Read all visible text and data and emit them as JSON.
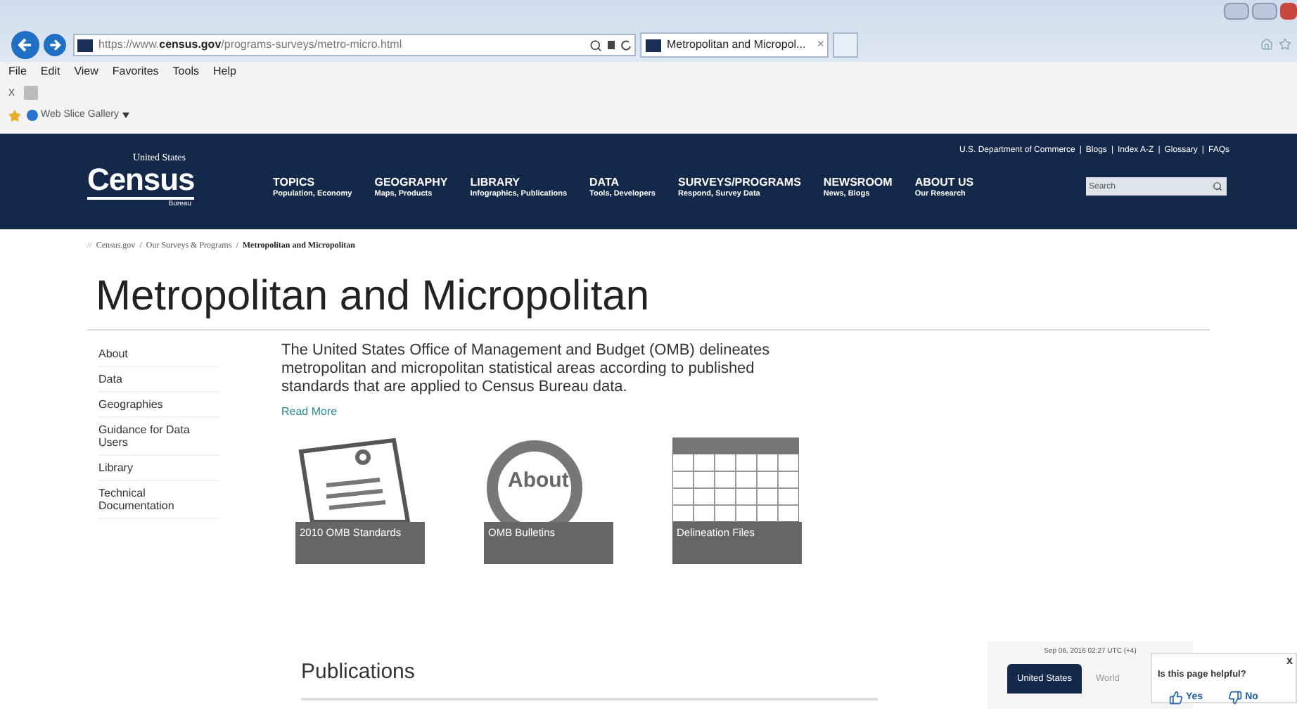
{
  "browser": {
    "url": "https://www.**census.gov**/programs-surveys/metro-micro.html",
    "tab_title": "Metropolitan and Micropol...",
    "tab_close": "×",
    "menu": [
      "File",
      "Edit",
      "View",
      "Favorites",
      "Tools",
      "Help"
    ],
    "command_close": "x",
    "favorites": [
      {
        "label": "Web Slice Gallery"
      }
    ]
  },
  "header": {
    "logo": {
      "top": "United States",
      "main": "Census",
      "bottom": "Bureau"
    },
    "top_links": [
      "U.S. Department of Commerce",
      "Blogs",
      "Index A-Z",
      "Glossary",
      "FAQs"
    ],
    "top_links_separator": "|",
    "nav": [
      {
        "title": "TOPICS",
        "subtitle": "Population, Economy"
      },
      {
        "title": "GEOGRAPHY",
        "subtitle": "Maps, Products"
      },
      {
        "title": "LIBRARY",
        "subtitle": "Infographics, Publications"
      },
      {
        "title": "DATA",
        "subtitle": "Tools, Developers"
      },
      {
        "title": "SURVEYS/PROGRAMS",
        "subtitle": "Respond, Survey Data"
      },
      {
        "title": "NEWSROOM",
        "subtitle": "News, Blogs"
      },
      {
        "title": "ABOUT US",
        "subtitle": "Our Research"
      }
    ],
    "search": {
      "placeholder": "Search"
    }
  },
  "breadcrumb": {
    "prefix": "//",
    "separator": "/",
    "items": [
      "Census.gov",
      "Our Surveys & Programs",
      "Metropolitan and Micropolitan"
    ]
  },
  "page_title": "Metropolitan and Micropolitan",
  "sidebar": {
    "items": [
      "About",
      "Data",
      "Geographies",
      "Guidance for Data Users",
      "Library",
      "Technical Documentation"
    ]
  },
  "intro": "The United States Office of Management and Budget (OMB) delineates metropolitan and micropolitan statistical areas according to published standards that are applied to Census Bureau data.",
  "read_more": "Read More",
  "tiles": [
    {
      "kind": "document",
      "caption": "2010 OMB Standards"
    },
    {
      "kind": "magnifier",
      "caption": "OMB Bulletins",
      "art_text": "About"
    },
    {
      "kind": "grid",
      "caption": "Delineation Files"
    }
  ],
  "publications": {
    "heading": "Publications"
  },
  "widget": {
    "timestamp": "Sep 06, 2016 02:27 UTC (+4)",
    "tabs": [
      {
        "label": "United States",
        "selected": true
      },
      {
        "label": "World",
        "selected": false
      }
    ]
  },
  "feedback": {
    "question": "Is this page helpful?",
    "yes": "Yes",
    "no": "No",
    "close": "x"
  }
}
